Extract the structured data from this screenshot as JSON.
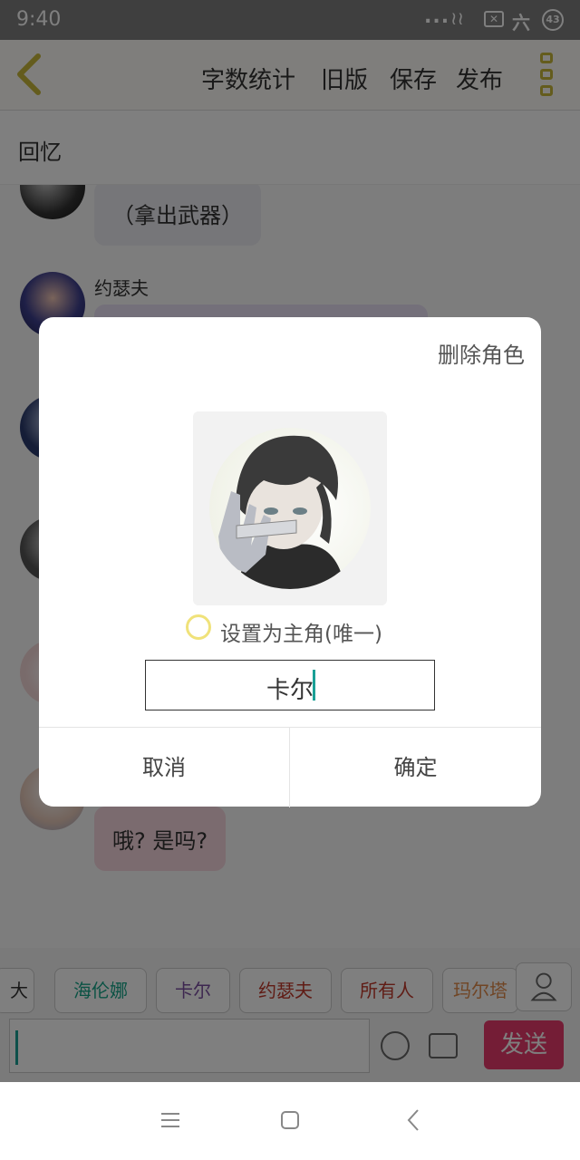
{
  "status_bar": {
    "time": "9:40",
    "dots": "...",
    "battery": "43",
    "carrier_glyph": "六"
  },
  "toolbar": {
    "menu": [
      "字数统计",
      "旧版",
      "保存",
      "发布"
    ]
  },
  "chapter": {
    "title": "回忆"
  },
  "chat": {
    "messages": [
      {
        "text": "（拿出武器）"
      },
      {
        "sender": "约瑟夫"
      },
      {
        "text": "哦? 是吗?"
      }
    ]
  },
  "role_tags": [
    "大大",
    "海伦娜",
    "卡尔",
    "约瑟夫",
    "所有人",
    "玛尔塔"
  ],
  "input_bar": {
    "send_label": "发送"
  },
  "dialog": {
    "delete_label": "删除角色",
    "main_role_label": "设置为主角(唯一)",
    "name_value": "卡尔",
    "cancel_label": "取消",
    "confirm_label": "确定"
  },
  "colors": {
    "accent": "#1aa096",
    "send": "#e83b6c",
    "radio": "#f0e27a",
    "toolbar_icon": "#c9b83a"
  },
  "icons": [
    "back-icon",
    "more-icon",
    "user-icon",
    "emoji-icon",
    "image-icon",
    "nav-menu-icon",
    "nav-home-icon",
    "nav-back-icon"
  ]
}
